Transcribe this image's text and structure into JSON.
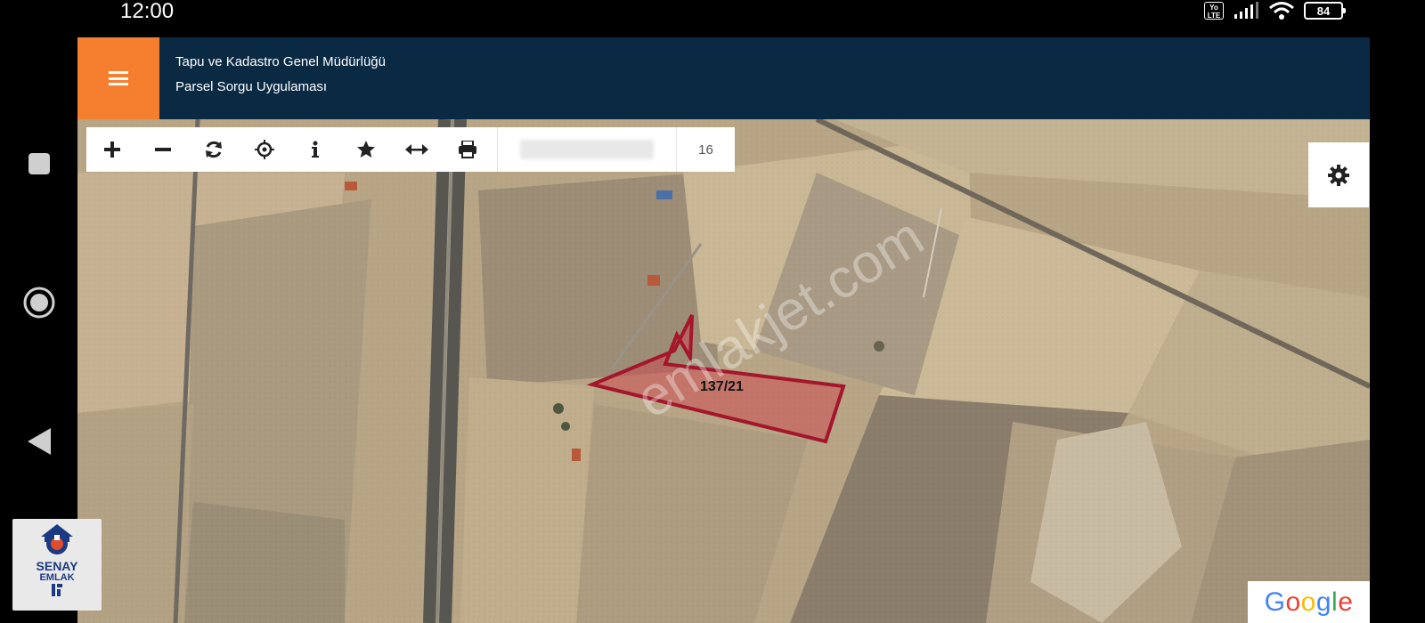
{
  "status_bar": {
    "time": "12:00",
    "network": "Yo LTE",
    "battery": "84"
  },
  "header": {
    "line1": "Tapu ve Kadastro Genel Müdürlüğü",
    "line2": "Parsel Sorgu Uygulaması"
  },
  "toolbar": {
    "tools": [
      {
        "name": "zoom-in",
        "icon": "plus-icon"
      },
      {
        "name": "zoom-out",
        "icon": "minus-icon"
      },
      {
        "name": "refresh",
        "icon": "refresh-icon"
      },
      {
        "name": "locate",
        "icon": "crosshair-icon"
      },
      {
        "name": "info",
        "icon": "info-icon"
      },
      {
        "name": "favorite",
        "icon": "star-icon"
      },
      {
        "name": "measure",
        "icon": "horizontal-arrows-icon"
      },
      {
        "name": "print",
        "icon": "printer-icon"
      }
    ],
    "zoom_level": "16"
  },
  "map": {
    "parcel_label": "137/21",
    "watermark": "emlakjet.com",
    "attribution": "Google",
    "parcel_color": "#a3162c"
  },
  "watermark_logo": {
    "title": "SENAY",
    "subtitle": "EMLAK"
  },
  "colors": {
    "header_bg": "#0a2a44",
    "menu_button": "#f57e2f"
  }
}
